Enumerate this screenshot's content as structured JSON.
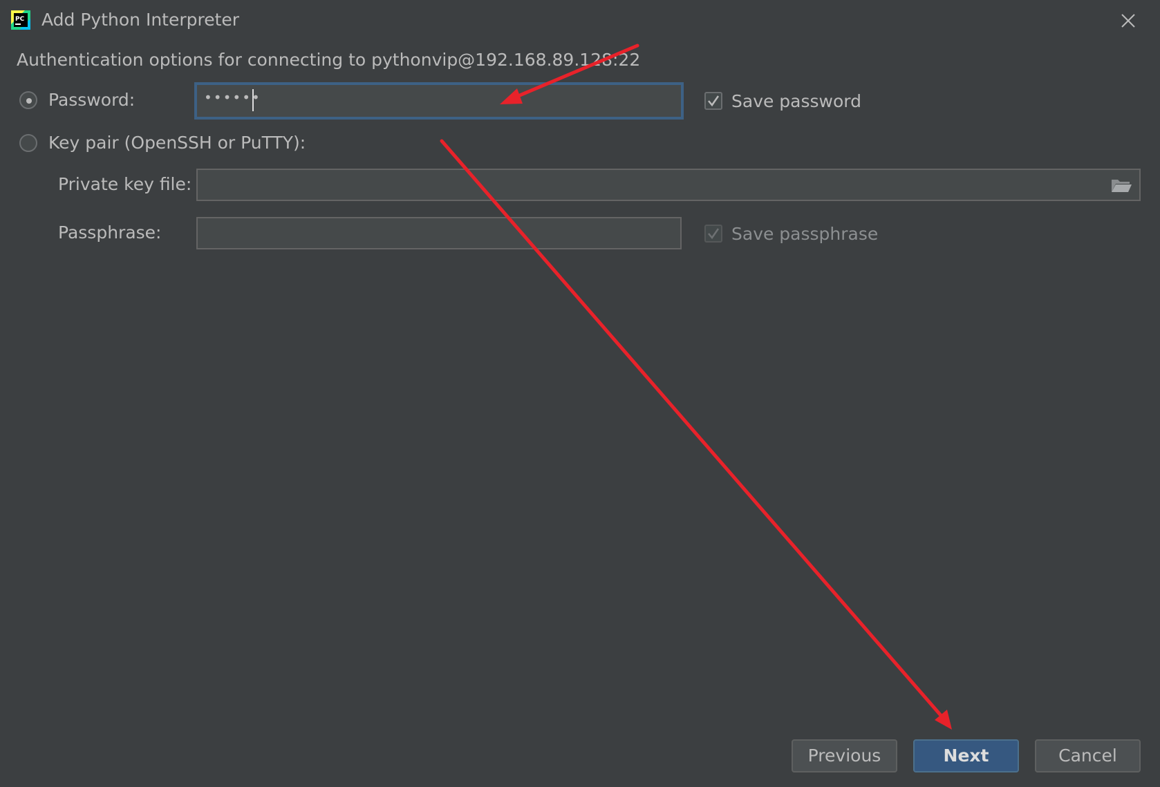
{
  "window": {
    "title": "Add Python Interpreter",
    "app_icon_text": "PC"
  },
  "auth": {
    "heading": "Authentication options for connecting to pythonvip@192.168.89.128:22",
    "password_option_label": "Password:",
    "password_selected": true,
    "password_value_masked": "••••••",
    "save_password_label": "Save password",
    "save_password_checked": true,
    "keypair_option_label": "Key pair (OpenSSH or PuTTY):",
    "keypair_selected": false,
    "private_key_label": "Private key file:",
    "private_key_value": "",
    "passphrase_label": "Passphrase:",
    "passphrase_value": "",
    "save_passphrase_label": "Save passphrase",
    "save_passphrase_checked": true
  },
  "footer": {
    "previous_label": "Previous",
    "next_label": "Next",
    "cancel_label": "Cancel"
  },
  "colors": {
    "background": "#3c3f41",
    "text": "#bbbbbb",
    "primary_button": "#365880",
    "focus_border": "#3d6185",
    "annotation_arrow": "#e8222a"
  },
  "icons": {
    "app": "pycharm-icon",
    "close": "close-icon",
    "browse": "folder-icon",
    "check": "checkmark-icon"
  }
}
